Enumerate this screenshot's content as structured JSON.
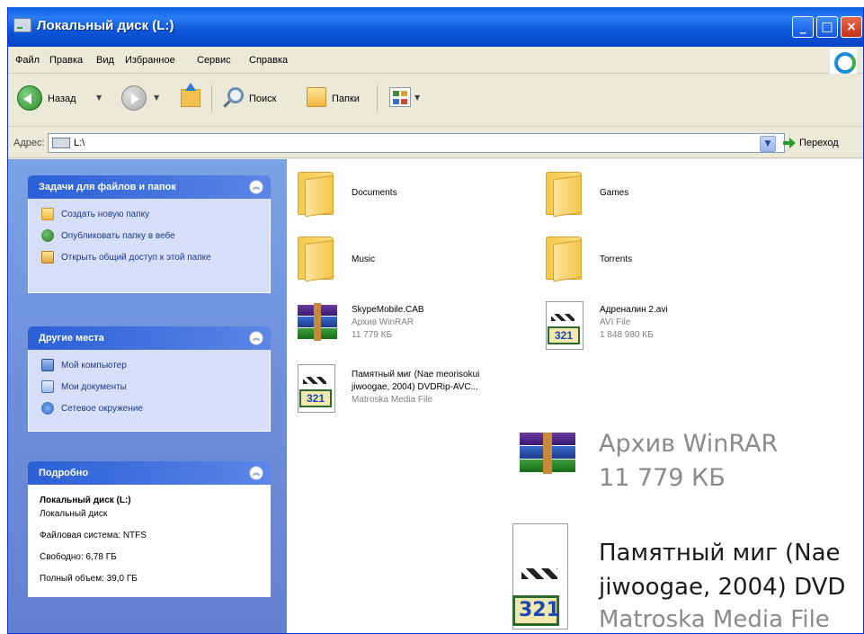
{
  "window": {
    "title": "Локальный диск (L:)"
  },
  "menu": [
    "Файл",
    "Правка",
    "Вид",
    "Избранное",
    "Сервис",
    "Справка"
  ],
  "toolbar": {
    "back_label": "Назад",
    "search_label": "Поиск",
    "folders_label": "Папки"
  },
  "address": {
    "label": "Адрес:",
    "value": "L:\\",
    "go_label": "Переход"
  },
  "panels": {
    "tasks": {
      "title": "Задачи для файлов и папок",
      "items": [
        "Создать новую папку",
        "Опубликовать папку в вебе",
        "Открыть общий доступ к этой папке"
      ]
    },
    "places": {
      "title": "Другие места",
      "items": [
        "Мой компьютер",
        "Мои документы",
        "Сетевое окружение"
      ]
    },
    "details": {
      "title": "Подробно",
      "name": "Локальный диск (L:)",
      "type": "Локальный диск",
      "fs": "Файловая система: NTFS",
      "free": "Свободно: 6,78 ГБ",
      "total": "Полный объем: 39,0 ГБ"
    }
  },
  "files": {
    "documents": {
      "name": "Documents"
    },
    "games": {
      "name": "Games"
    },
    "music": {
      "name": "Music"
    },
    "torrents": {
      "name": "Torrents"
    },
    "skype": {
      "name": "SkypeMobile.CAB",
      "type": "Архив WinRAR",
      "size": "11 779 КБ"
    },
    "adrenaline": {
      "name": "Адреналин 2.avi",
      "type": "AVI File",
      "size": "1 848 980 КБ"
    },
    "memory": {
      "name_line1": "Памятный миг (Nae meorisokui",
      "name_line2": "jiwoogae, 2004) DVDRip-AVC...",
      "type": "Matroska Media File"
    }
  },
  "zoom": {
    "rar_type": "Архив WinRAR",
    "rar_size": "11 779 КБ",
    "mkv_line1": "Памятный миг (Nae",
    "mkv_line2": "jiwoogae, 2004) DVD",
    "mkv_type": "Matroska Media File"
  },
  "icon_badge": "321"
}
